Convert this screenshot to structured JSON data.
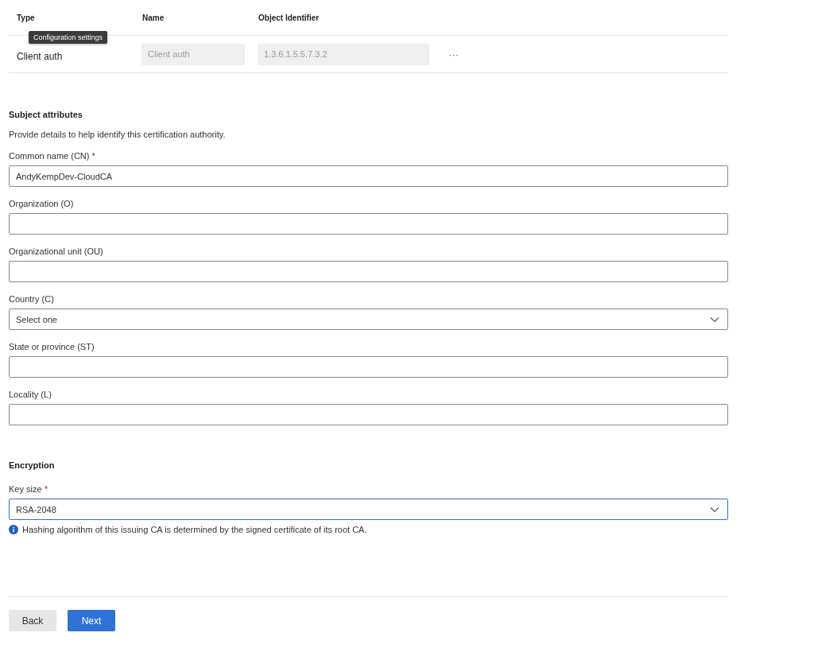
{
  "table": {
    "columns": [
      "Type",
      "Name",
      "Object Identifier"
    ],
    "rows": [
      {
        "type": "Client auth",
        "name": "Client auth",
        "oid": "1.3.6.1.5.5.7.3.2",
        "more": "···"
      }
    ],
    "tooltip": "Configuration settings"
  },
  "subject": {
    "title": "Subject attributes",
    "description": "Provide details to help identify this certification authority.",
    "fields": [
      {
        "kind": "text",
        "label": "Common name (CN)",
        "required_mark": "*",
        "value": "AndyKempDev-CloudCA",
        "focused": false
      },
      {
        "kind": "text",
        "label": "Organization (O)",
        "focused": false
      },
      {
        "kind": "text",
        "label": "Organizational unit (OU)",
        "focused": false
      },
      {
        "kind": "dropdown",
        "label": "Country (C)",
        "value": "Select one",
        "focused": false
      },
      {
        "kind": "text",
        "label": "State or province (ST)",
        "focused": false
      },
      {
        "kind": "text",
        "label": "Locality (L)",
        "focused": false
      }
    ]
  },
  "encryption": {
    "title": "Encryption",
    "fields": [
      {
        "kind": "dropdown",
        "label": "Key size",
        "required_mark": "*",
        "value": "RSA-2048",
        "focused": true
      }
    ],
    "info": "Hashing algorithm of this issuing CA is determined by the signed certificate of its root CA."
  },
  "buttons": [
    {
      "label": "Back",
      "primary": false
    },
    {
      "label": "Next",
      "primary": true
    }
  ]
}
